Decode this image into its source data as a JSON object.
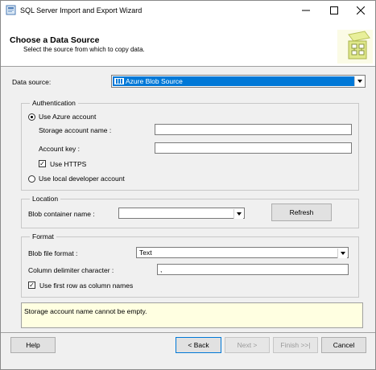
{
  "window": {
    "title": "SQL Server Import and Export Wizard",
    "controls": {
      "minimize": "—",
      "maximize": "☐",
      "close": "✕"
    }
  },
  "header": {
    "title": "Choose a Data Source",
    "subtitle": "Select the source from which to copy data."
  },
  "data_source": {
    "label": "Data source:",
    "selected": "Azure Blob Source",
    "icon": "grid-table-icon"
  },
  "authentication": {
    "legend": "Authentication",
    "use_azure_label": "Use Azure account",
    "use_azure_selected": true,
    "storage_account_label": "Storage account name :",
    "storage_account_value": "",
    "account_key_label": "Account key :",
    "account_key_value": "",
    "use_https_label": "Use HTTPS",
    "use_https_checked": true,
    "use_local_label": "Use local developer account",
    "use_local_selected": false
  },
  "location": {
    "legend": "Location",
    "container_label": "Blob container name :",
    "container_value": "",
    "refresh_label": "Refresh"
  },
  "format": {
    "legend": "Format",
    "file_format_label": "Blob file format :",
    "file_format_value": "Text",
    "delimiter_label": "Column delimiter character :",
    "delimiter_value": ",",
    "first_row_label": "Use first row as column names",
    "first_row_checked": true
  },
  "message": "Storage account name cannot be empty.",
  "footer": {
    "help": "Help",
    "back": "< Back",
    "next": "Next >",
    "finish": "Finish >>|",
    "cancel": "Cancel"
  },
  "colors": {
    "selection": "#0078d7",
    "message_bg": "#ffffe1",
    "window_bg": "#f0f0f0"
  }
}
